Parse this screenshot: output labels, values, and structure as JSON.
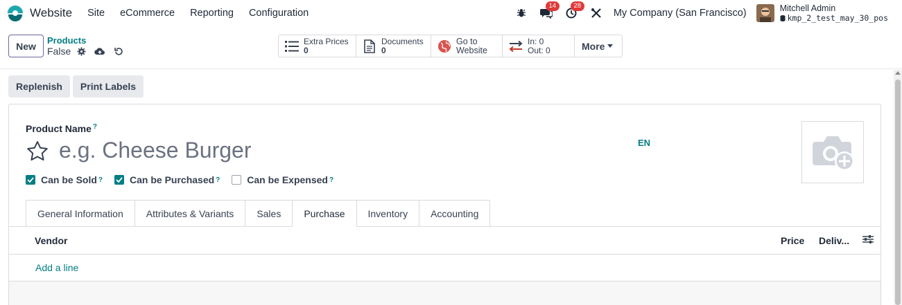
{
  "nav": {
    "app_name": "Website",
    "menu": [
      "Site",
      "eCommerce",
      "Reporting",
      "Configuration"
    ],
    "messages_count": "14",
    "activities_count": "28",
    "company": "My Company (San Francisco)",
    "user_name": "Mitchell Admin",
    "db_name": "kmp_2_test_may_30_pos"
  },
  "control": {
    "new_label": "New",
    "breadcrumb": "Products",
    "record_name": "False",
    "smart_buttons": {
      "extra_prices_label": "Extra Prices",
      "extra_prices_value": "0",
      "documents_label": "Documents",
      "documents_value": "0",
      "website_line1": "Go to",
      "website_line2": "Website",
      "in_label": "In: 0",
      "out_label": "Out: 0",
      "more_label": "More"
    }
  },
  "actions": {
    "replenish": "Replenish",
    "print_labels": "Print Labels"
  },
  "form": {
    "product_name_label": "Product Name",
    "help_mark": "?",
    "name_placeholder": "e.g. Cheese Burger",
    "lang": "EN",
    "checks": [
      {
        "label": "Can be Sold",
        "checked": true
      },
      {
        "label": "Can be Purchased",
        "checked": true
      },
      {
        "label": "Can be Expensed",
        "checked": false
      }
    ],
    "tabs": [
      "General Information",
      "Attributes & Variants",
      "Sales",
      "Purchase",
      "Inventory",
      "Accounting"
    ],
    "active_tab": "Purchase",
    "list": {
      "col_vendor": "Vendor",
      "col_price": "Price",
      "col_delivery": "Deliv...",
      "add_line": "Add a line"
    }
  },
  "colors": {
    "accent": "#017e84",
    "brand_purple": "#71639e",
    "badge_red": "#e03a3a"
  }
}
